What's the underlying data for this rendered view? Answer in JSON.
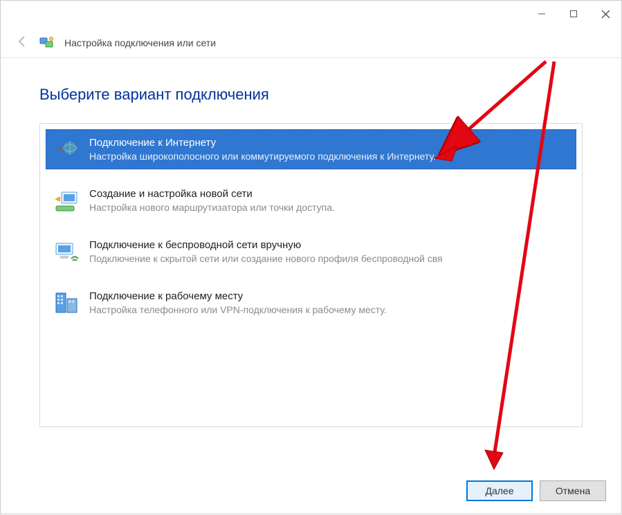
{
  "header": {
    "title": "Настройка подключения или сети"
  },
  "page": {
    "title": "Выберите вариант подключения"
  },
  "options": [
    {
      "title": "Подключение к Интернету",
      "desc": "Настройка широкополосного или коммутируемого подключения к Интернету."
    },
    {
      "title": "Создание и настройка новой сети",
      "desc": "Настройка нового маршрутизатора или точки доступа."
    },
    {
      "title": "Подключение к беспроводной сети вручную",
      "desc": "Подключение к скрытой сети или создание нового профиля беспроводной свя"
    },
    {
      "title": "Подключение к рабочему месту",
      "desc": "Настройка телефонного или VPN-подключения к рабочему месту."
    }
  ],
  "buttons": {
    "next": "Далее",
    "cancel": "Отмена"
  }
}
